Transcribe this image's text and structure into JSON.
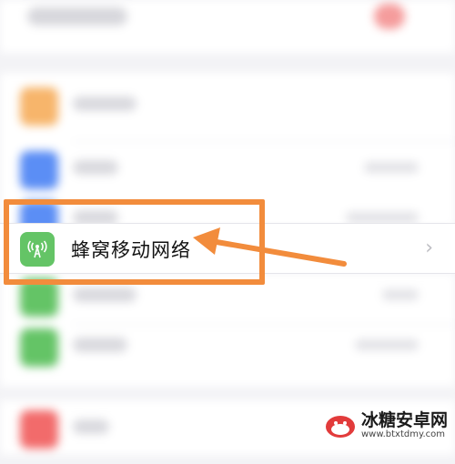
{
  "cell_item": {
    "label": "蜂窝移动网络",
    "icon": "antenna-icon",
    "chevron": "›"
  },
  "blurred_rows": [
    {
      "icon_color": "#f7b56b"
    },
    {
      "icon_color": "#5b8ef5"
    },
    {
      "icon_color": "#5b8ef5"
    },
    {
      "icon_color": "#64c466"
    },
    {
      "icon_color": "#64c466"
    },
    {
      "icon_color": "#f26b6b"
    }
  ],
  "highlight": {
    "color": "#f28c3c"
  },
  "watermark": {
    "title": "冰糖安卓网",
    "url": "www.btxtdmy.com"
  }
}
